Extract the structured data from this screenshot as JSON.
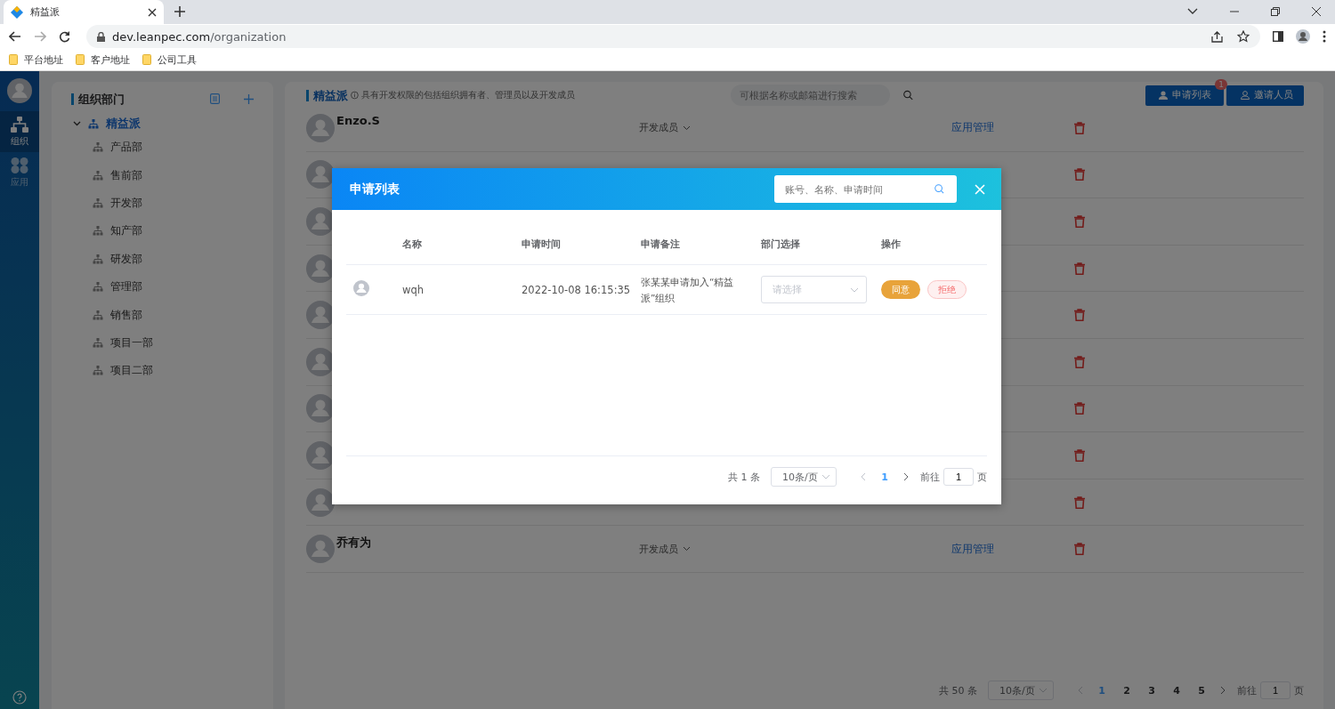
{
  "browser": {
    "tab_title": "精益派",
    "url_host": "dev.leanpec.com",
    "url_path": "/organization",
    "bookmarks": [
      "平台地址",
      "客户地址",
      "公司工具"
    ]
  },
  "nav": {
    "items": [
      {
        "label": "组织",
        "kind": "org",
        "selected": true
      },
      {
        "label": "应用",
        "kind": "apps",
        "selected": false
      }
    ]
  },
  "departments": {
    "title": "组织部门",
    "root": {
      "label": "精益派",
      "expanded": true,
      "children": [
        {
          "label": "产品部"
        },
        {
          "label": "售前部"
        },
        {
          "label": "开发部"
        },
        {
          "label": "知产部"
        },
        {
          "label": "研发部"
        },
        {
          "label": "管理部"
        },
        {
          "label": "销售部"
        },
        {
          "label": "项目一部"
        },
        {
          "label": "项目二部"
        }
      ]
    }
  },
  "org": {
    "title": "精益派",
    "hint": "具有开发权限的包括组织拥有者、管理员以及开发成员",
    "search_placeholder": "可根据名称或邮箱进行搜索",
    "apply_button": "申请列表",
    "apply_badge": "1",
    "invite_button": "邀请人员"
  },
  "members": [
    {
      "kind": "full",
      "name": "Enzo.S",
      "role": "开发成员",
      "action": "应用管理"
    },
    {
      "kind": "covered"
    },
    {
      "kind": "covered"
    },
    {
      "kind": "covered"
    },
    {
      "kind": "covered"
    },
    {
      "kind": "covered"
    },
    {
      "kind": "covered"
    },
    {
      "kind": "covered"
    },
    {
      "kind": "covered"
    },
    {
      "kind": "full",
      "name": "乔有为",
      "role": "开发成员",
      "action": "应用管理"
    }
  ],
  "pagination": {
    "total": "共 50 条",
    "page_size": "10条/页",
    "pages": [
      {
        "label": "1",
        "selected": true
      },
      {
        "label": "2",
        "selected": false
      },
      {
        "label": "3",
        "selected": false
      },
      {
        "label": "4",
        "selected": false
      },
      {
        "label": "5",
        "selected": false
      }
    ],
    "goto_label": "前往",
    "goto_value": "1",
    "goto_unit": "页"
  },
  "modal": {
    "title": "申请列表",
    "search_placeholder": "账号、名称、申请时间",
    "columns": [
      "名称",
      "申请时间",
      "申请备注",
      "部门选择",
      "操作"
    ],
    "rows": [
      {
        "name": "wqh",
        "time": "2022-10-08 16:15:35",
        "note": "张某某申请加入“精益派”组织",
        "department_placeholder": "请选择",
        "approve": "同意",
        "reject": "拒绝"
      }
    ],
    "pagination": {
      "total": "共 1 条",
      "page_size": "10条/页",
      "pages": [
        {
          "label": "1",
          "selected": true
        }
      ],
      "goto_label": "前往",
      "goto_value": "1",
      "goto_unit": "页"
    }
  }
}
